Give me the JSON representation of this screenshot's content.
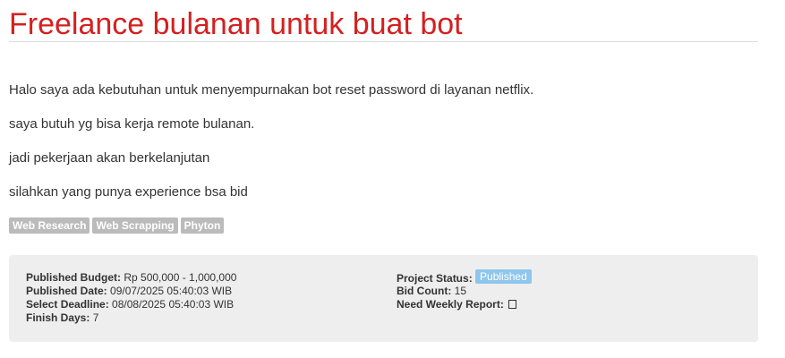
{
  "project": {
    "title": "Freelance bulanan untuk buat bot",
    "description": [
      "Halo saya ada kebutuhan untuk menyempurnakan bot reset password di layanan netflix.",
      "saya butuh yg bisa kerja remote bulanan.",
      "jadi pekerjaan akan berkelanjutan",
      "silahkan yang punya experience bsa bid"
    ],
    "tags": [
      "Web Research",
      "Web Scrapping",
      "Phyton"
    ]
  },
  "details": {
    "published_budget_label": "Published Budget:",
    "published_budget_value": "Rp 500,000 - 1,000,000",
    "published_date_label": "Published Date:",
    "published_date_value": "09/07/2025 05:40:03 WIB",
    "select_deadline_label": "Select Deadline:",
    "select_deadline_value": "08/08/2025 05:40:03 WIB",
    "finish_days_label": "Finish Days:",
    "finish_days_value": "7",
    "project_status_label": "Project Status:",
    "project_status_value": "Published",
    "bid_count_label": "Bid Count:",
    "bid_count_value": "15",
    "need_weekly_report_label": "Need Weekly Report:"
  },
  "colors": {
    "title": "#d42020",
    "tag_bg": "#bbbbbb",
    "status_badge_bg": "#8ec6ec",
    "panel_bg": "#eeeeee"
  },
  "icons": {
    "weekly_report": "checkbox-icon"
  }
}
